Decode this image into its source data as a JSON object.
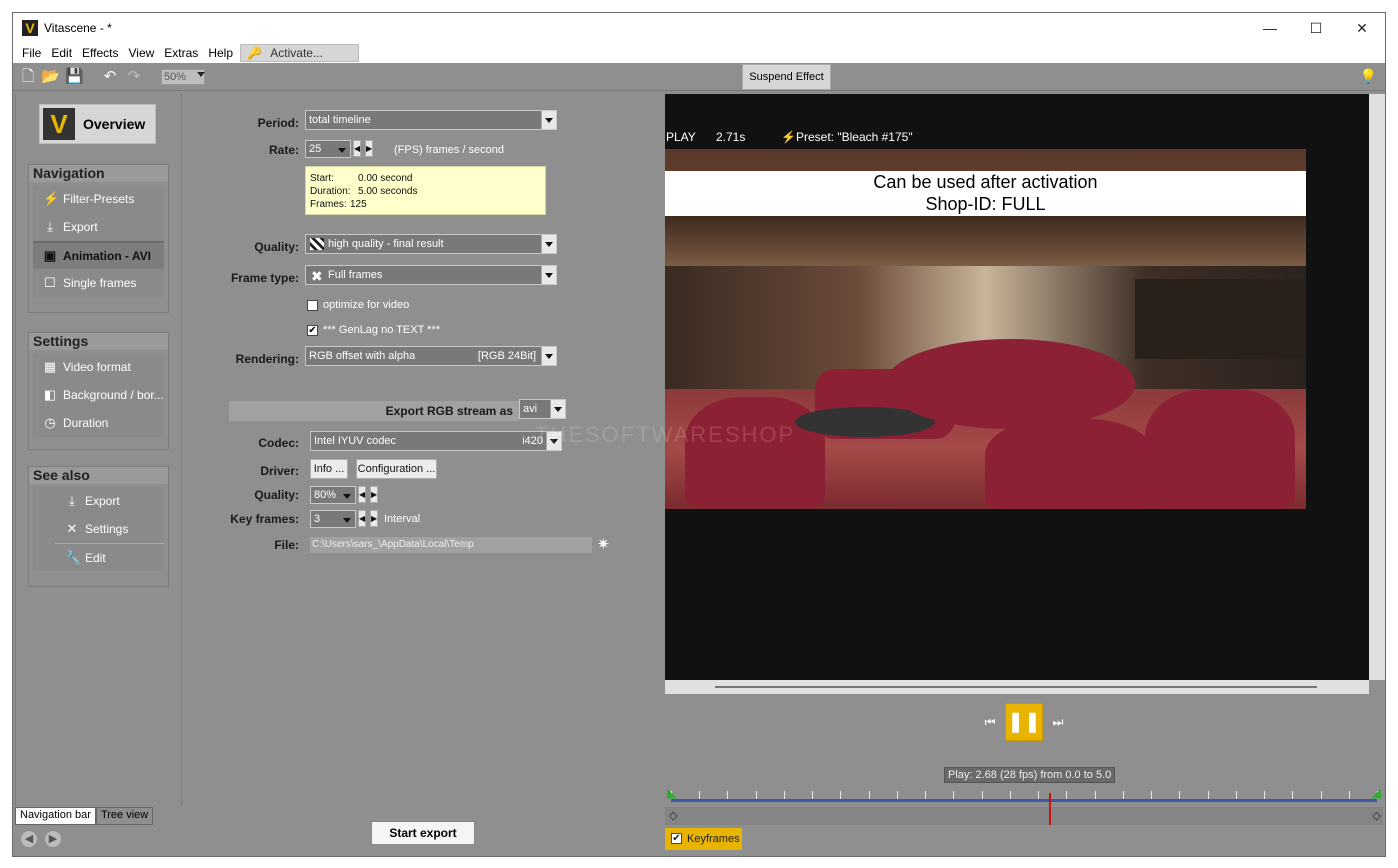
{
  "window": {
    "title": "Vitascene - *",
    "min": "—",
    "max": "☐",
    "close": "✕"
  },
  "menu": [
    "File",
    "Edit",
    "Effects",
    "View",
    "Extras",
    "Help"
  ],
  "activate_label": "Activate...",
  "toolbar": {
    "zoom": "50%",
    "suspend_label": "Suspend Effect"
  },
  "nav": {
    "overview_label": "Overview",
    "navigation": {
      "heading": "Navigation",
      "items": [
        "Filter-Presets",
        "Export",
        "Animation - AVI",
        "Single frames"
      ]
    },
    "settings": {
      "heading": "Settings",
      "items": [
        "Video format",
        "Background / bor...",
        "Duration"
      ]
    },
    "see_also": {
      "heading": "See also",
      "items": [
        "Export",
        "Settings",
        "Edit"
      ]
    },
    "tabs": [
      "Navigation bar",
      "Tree view"
    ]
  },
  "form": {
    "period_label": "Period:",
    "period_value": "total timeline",
    "rate_label": "Rate:",
    "rate_value": "25",
    "rate_unit": "(FPS) frames / second",
    "info": {
      "start_k": "Start:",
      "start_v": "0.00 second",
      "duration_k": "Duration:",
      "duration_v": "5.00 seconds",
      "frames_k": "Frames:",
      "frames_v": "125"
    },
    "quality_label": "Quality:",
    "quality_value": "high quality - final result",
    "frametype_label": "Frame type:",
    "frametype_value": "Full frames",
    "optimize_label": "optimize for video",
    "optimize_checked": false,
    "genlag_label": "*** GenLag no TEXT ***",
    "genlag_checked": true,
    "rendering_label": "Rendering:",
    "rendering_value": "RGB offset with alpha",
    "rendering_fmt": "[RGB 24Bit]",
    "export_as_label": "Export RGB stream as",
    "export_as_value": "avi",
    "codec_label": "Codec:",
    "codec_value": "Intel IYUV codec",
    "codec_fourcc": "i420",
    "driver_label": "Driver:",
    "info_btn": "Info ...",
    "config_btn": "Configuration ...",
    "quality2_label": "Quality:",
    "quality2_value": "80%",
    "keyframes_label": "Key frames:",
    "keyframes_value": "3",
    "keyframes_unit": "Interval",
    "file_label": "File:",
    "file_value": "C:\\Users\\sars_\\AppData\\Local\\Temp",
    "start_export": "Start export"
  },
  "preview": {
    "mode": "PLAY",
    "time": "2.71s",
    "preset": "Preset: \"Bleach #175\"",
    "banner_line1": "Can be used after activation",
    "banner_line2": "Shop-ID:  FULL",
    "watermark": "THESOFTWARESHOP"
  },
  "transport": {
    "play_info": "Play: 2.68 (28 fps) from 0.0 to 5.0",
    "playhead_fraction": 0.536
  },
  "keyframes_toggle": {
    "label": "Keyframes",
    "checked": true
  },
  "colors": {
    "accent": "#e8b400",
    "panel": "#8f8f8f",
    "timeline": "#3a5aa8",
    "playhead": "#cc1111"
  }
}
